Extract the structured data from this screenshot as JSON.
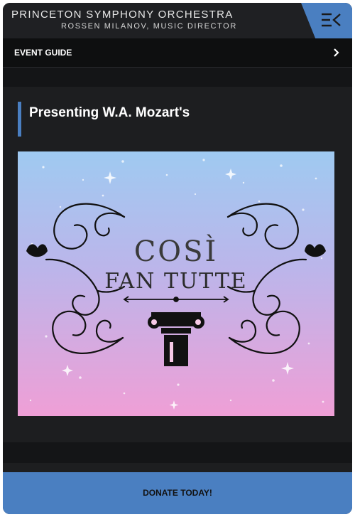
{
  "header": {
    "org_name": "PRINCETON SYMPHONY ORCHESTRA",
    "org_subtitle": "ROSSEN MILANOV, MUSIC DIRECTOR",
    "menu_icon": "menu-collapse-icon"
  },
  "event_guide": {
    "label": "EVENT GUIDE",
    "chevron_icon": "chevron-right-icon"
  },
  "main": {
    "title": "Presenting W.A. Mozart's",
    "poster": {
      "line1": "COSÌ",
      "line2": "FAN TUTTE"
    }
  },
  "footer": {
    "donate_label": "DONATE TODAY!"
  },
  "colors": {
    "accent": "#4a7fc1",
    "background": "#1d1e20",
    "bar": "#0e0f10"
  }
}
